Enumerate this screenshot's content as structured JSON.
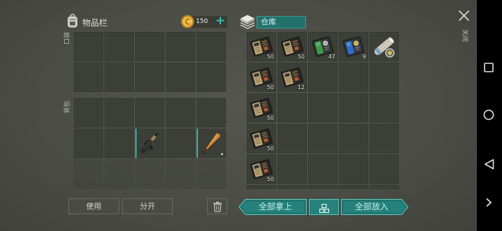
{
  "header": {
    "inventory_title": "物品栏",
    "coin_amount": "150",
    "add_coins_label": "+",
    "storage_title": "仓库",
    "close_label": "关闭"
  },
  "inventory": {
    "pocket_label": "口袋",
    "backpack_label": "背包",
    "pocket_slots": [
      null,
      null,
      null,
      null,
      null,
      null,
      null,
      null,
      null,
      null
    ],
    "backpack_slots": [
      null,
      null,
      null,
      null,
      null,
      null,
      null,
      {
        "icon": "assault-rifle-icon",
        "selected_marker": true
      },
      null,
      {
        "icon": "baseball-bat-icon",
        "selected_marker": true,
        "durability_dot": true
      },
      {
        "locked": true
      },
      {
        "locked": true
      },
      {
        "locked": true
      },
      {
        "locked": true
      },
      {
        "locked": true
      }
    ]
  },
  "storage": {
    "slots": [
      {
        "icon": "manual-book-icon",
        "count": "50"
      },
      {
        "icon": "manual-book-icon",
        "count": "50"
      },
      {
        "icon": "green-manual-icon",
        "count": "47"
      },
      {
        "icon": "blue-manual-icon",
        "count": "9"
      },
      {
        "icon": "blueprint-scroll-icon"
      },
      {
        "icon": "manual-book-icon",
        "count": "50"
      },
      {
        "icon": "manual-book-icon",
        "count": "12"
      },
      null,
      null,
      null,
      {
        "icon": "manual-book-icon",
        "count": "50"
      },
      null,
      null,
      null,
      null,
      {
        "icon": "manual-book-icon",
        "count": "50"
      },
      null,
      null,
      null,
      null,
      {
        "icon": "manual-book-icon",
        "count": "50"
      },
      null,
      null,
      null,
      null,
      null,
      null,
      null,
      null,
      null
    ]
  },
  "actions": {
    "use_label": "使用",
    "split_label": "分开",
    "take_all_label": "全部拿上",
    "put_all_label": "全部放入"
  },
  "icons": {
    "header": [
      "backpack-icon",
      "coin-icon",
      "storage-icon",
      "close-icon"
    ],
    "actions": [
      "trash-icon",
      "sort-icon"
    ],
    "system_nav": [
      "nav-recents-icon",
      "nav-home-icon",
      "nav-back-icon",
      "nav-expand-icon"
    ]
  },
  "colors": {
    "accent_teal": "#2a857f",
    "accent_teal_border": "#5fc4bb",
    "coin_gold": "#f0be4c",
    "panel_bg": "#4b4d46",
    "slot_bg": "#3c3e38"
  }
}
